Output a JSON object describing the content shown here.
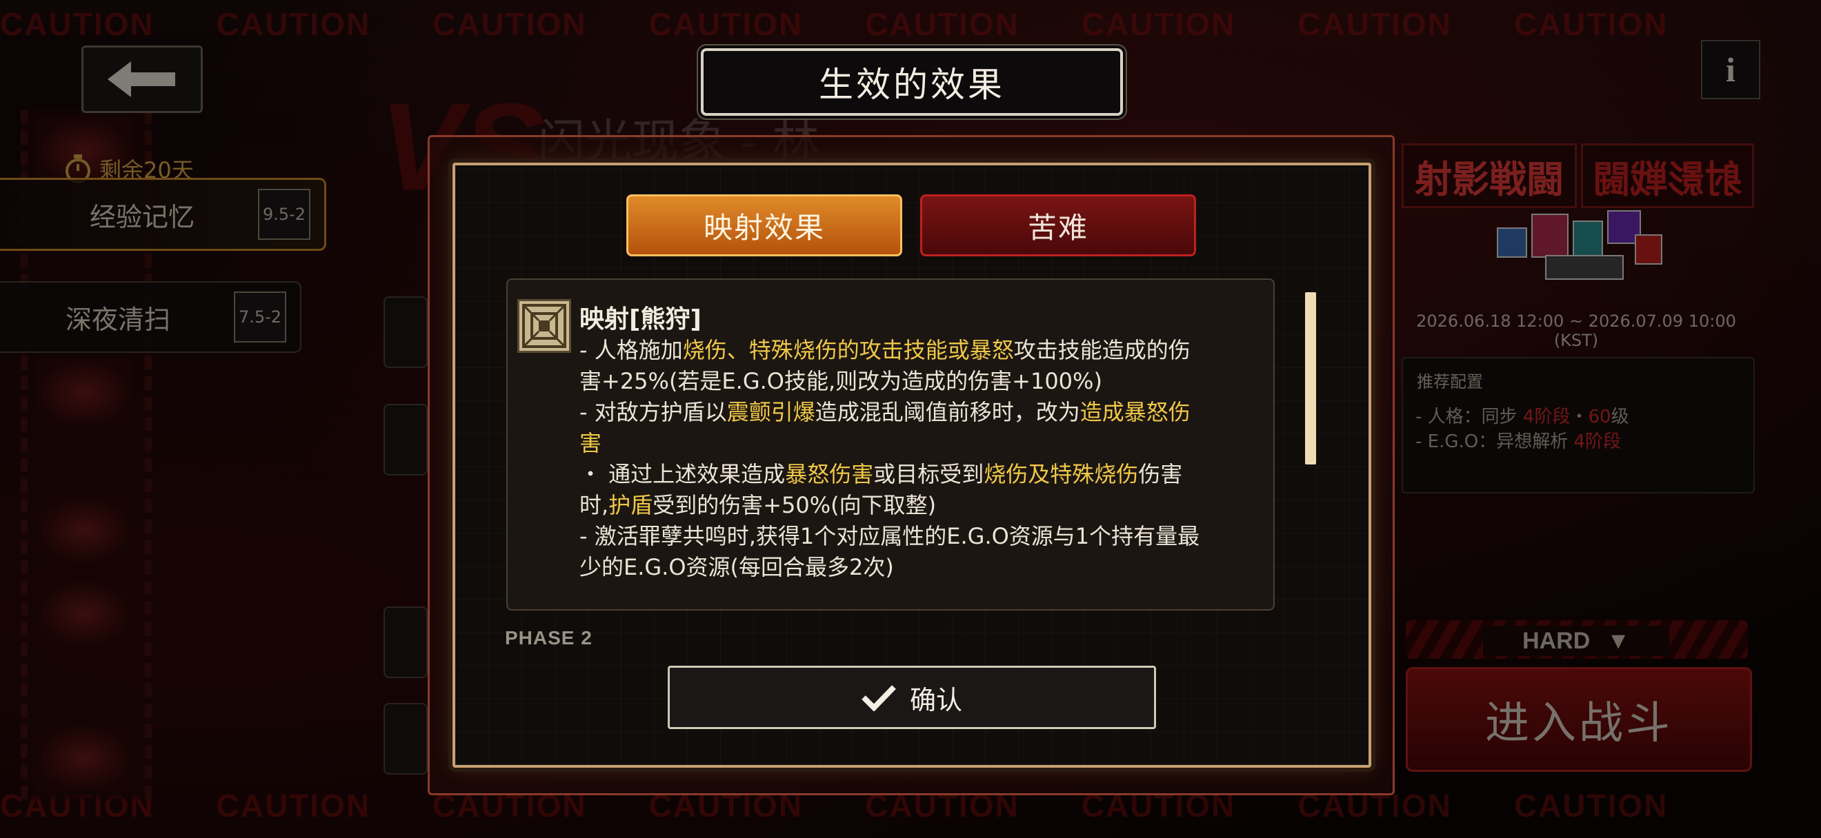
{
  "background": {
    "caution_word": "CAUTION",
    "stage_title": "闪光现象 - 林",
    "vs_text": "VS"
  },
  "left_panel": {
    "back_icon": "arrow-left-icon",
    "timer_icon": "stopwatch-icon",
    "time_remaining": "剩余20天",
    "stages": [
      {
        "label": "经验记忆",
        "code": "9.5-2"
      },
      {
        "label": "深夜清扫",
        "code": "7.5-2"
      }
    ]
  },
  "right_panel": {
    "info_label": "i",
    "event_title": "射影戦闘",
    "event_dates": "2026.06.18 12:00 ~ 2026.07.09 10:00 (KST)",
    "recommended": {
      "title": "推荐配置",
      "persona_prefix": "- 人格：同步 ",
      "persona_stage": "4阶段",
      "persona_sep": "・",
      "persona_level": "60",
      "persona_suffix": "级",
      "ego_prefix": "- E.G.O：异想解析 ",
      "ego_stage": "4阶段"
    },
    "difficulty": "HARD",
    "enter_label": "进入战斗"
  },
  "modal": {
    "title": "生效的效果",
    "tabs": [
      {
        "label": "映射效果",
        "active": true
      },
      {
        "label": "苦难",
        "active": false
      }
    ],
    "effect": {
      "icon": "nested-square-icon",
      "title": "映射[熊狩]",
      "l1a": "- 人格施加",
      "l1b": "烧伤、特殊烧伤的攻击技能或暴怒",
      "l1c": "攻击技能造成的伤",
      "l2": "害+25%(若是E.G.O技能,则改为造成的伤害+100%)",
      "l3a": "- 对敌方护盾以",
      "l3b": "震颤引爆",
      "l3c": "造成混乱阈值前移时，改为",
      "l3d": "造成暴怒伤",
      "l4": "害",
      "l5a": "・ 通过上述效果造成",
      "l5b": "暴怒伤害",
      "l5c": "或目标受到",
      "l5d": "烧伤及特殊烧伤",
      "l5e": "伤害",
      "l6a": "时,",
      "l6b": "护盾",
      "l6c": "受到的伤害+50%(向下取整)",
      "l7": "- 激活罪孽共鸣时,获得1个对应属性的E.G.O资源与1个持有量最",
      "l8": "少的E.G.O资源(每回合最多2次)"
    },
    "next_section": "PHASE 2",
    "confirm_icon": "checkmark-icon",
    "confirm_label": "确认"
  }
}
